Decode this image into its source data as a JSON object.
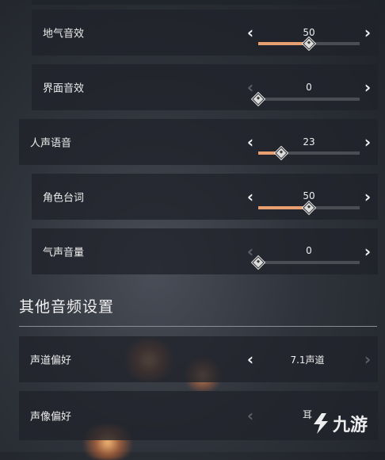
{
  "sliders": [
    {
      "id": "ambient",
      "label": "地气音效",
      "value": "50",
      "level": 0.5,
      "left_enabled": true,
      "right_enabled": true
    },
    {
      "id": "ui",
      "label": "界面音效",
      "value": "0",
      "level": 0.0,
      "left_enabled": false,
      "right_enabled": true
    },
    {
      "id": "voice",
      "label": "人声语音",
      "value": "23",
      "level": 0.23,
      "left_enabled": true,
      "right_enabled": true
    },
    {
      "id": "dialogue",
      "label": "角色台词",
      "value": "50",
      "level": 0.5,
      "left_enabled": true,
      "right_enabled": true
    },
    {
      "id": "breath",
      "label": "气声音量",
      "value": "0",
      "level": 0.0,
      "left_enabled": false,
      "right_enabled": true
    }
  ],
  "other_section": {
    "title": "其他音频设置",
    "items": [
      {
        "id": "channel",
        "label": "声道偏好",
        "value": "7.1声道",
        "left_enabled": true,
        "right_enabled": false
      },
      {
        "id": "image",
        "label": "声像偏好",
        "value": "耳",
        "left_enabled": false,
        "right_enabled": false
      }
    ]
  },
  "watermark": {
    "text": "九游"
  },
  "colors": {
    "accent": "#e8a070",
    "track": "#4a4d54",
    "row_bg": "#20232a"
  }
}
